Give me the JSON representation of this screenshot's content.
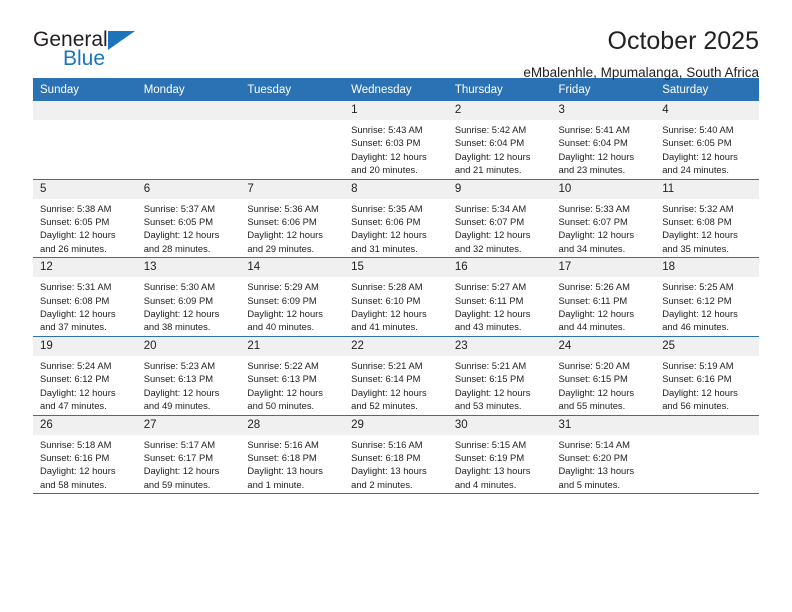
{
  "logo": {
    "word_top": "General",
    "word_bottom": "Blue",
    "triangle_color": "#1b75bc"
  },
  "header": {
    "title": "October 2025",
    "subtitle": "eMbalenhle, Mpumalanga, South Africa",
    "accent_color": "#2b72b4",
    "daynum_band_color": "#f0f0f0"
  },
  "calendar": {
    "weekday_headers": [
      "Sunday",
      "Monday",
      "Tuesday",
      "Wednesday",
      "Thursday",
      "Friday",
      "Saturday"
    ],
    "weeks": [
      [
        {
          "day": "",
          "lines": []
        },
        {
          "day": "",
          "lines": []
        },
        {
          "day": "",
          "lines": []
        },
        {
          "day": "1",
          "lines": [
            "Sunrise: 5:43 AM",
            "Sunset: 6:03 PM",
            "Daylight: 12 hours",
            "and 20 minutes."
          ]
        },
        {
          "day": "2",
          "lines": [
            "Sunrise: 5:42 AM",
            "Sunset: 6:04 PM",
            "Daylight: 12 hours",
            "and 21 minutes."
          ]
        },
        {
          "day": "3",
          "lines": [
            "Sunrise: 5:41 AM",
            "Sunset: 6:04 PM",
            "Daylight: 12 hours",
            "and 23 minutes."
          ]
        },
        {
          "day": "4",
          "lines": [
            "Sunrise: 5:40 AM",
            "Sunset: 6:05 PM",
            "Daylight: 12 hours",
            "and 24 minutes."
          ]
        }
      ],
      [
        {
          "day": "5",
          "lines": [
            "Sunrise: 5:38 AM",
            "Sunset: 6:05 PM",
            "Daylight: 12 hours",
            "and 26 minutes."
          ]
        },
        {
          "day": "6",
          "lines": [
            "Sunrise: 5:37 AM",
            "Sunset: 6:05 PM",
            "Daylight: 12 hours",
            "and 28 minutes."
          ]
        },
        {
          "day": "7",
          "lines": [
            "Sunrise: 5:36 AM",
            "Sunset: 6:06 PM",
            "Daylight: 12 hours",
            "and 29 minutes."
          ]
        },
        {
          "day": "8",
          "lines": [
            "Sunrise: 5:35 AM",
            "Sunset: 6:06 PM",
            "Daylight: 12 hours",
            "and 31 minutes."
          ]
        },
        {
          "day": "9",
          "lines": [
            "Sunrise: 5:34 AM",
            "Sunset: 6:07 PM",
            "Daylight: 12 hours",
            "and 32 minutes."
          ]
        },
        {
          "day": "10",
          "lines": [
            "Sunrise: 5:33 AM",
            "Sunset: 6:07 PM",
            "Daylight: 12 hours",
            "and 34 minutes."
          ]
        },
        {
          "day": "11",
          "lines": [
            "Sunrise: 5:32 AM",
            "Sunset: 6:08 PM",
            "Daylight: 12 hours",
            "and 35 minutes."
          ]
        }
      ],
      [
        {
          "day": "12",
          "lines": [
            "Sunrise: 5:31 AM",
            "Sunset: 6:08 PM",
            "Daylight: 12 hours",
            "and 37 minutes."
          ]
        },
        {
          "day": "13",
          "lines": [
            "Sunrise: 5:30 AM",
            "Sunset: 6:09 PM",
            "Daylight: 12 hours",
            "and 38 minutes."
          ]
        },
        {
          "day": "14",
          "lines": [
            "Sunrise: 5:29 AM",
            "Sunset: 6:09 PM",
            "Daylight: 12 hours",
            "and 40 minutes."
          ]
        },
        {
          "day": "15",
          "lines": [
            "Sunrise: 5:28 AM",
            "Sunset: 6:10 PM",
            "Daylight: 12 hours",
            "and 41 minutes."
          ]
        },
        {
          "day": "16",
          "lines": [
            "Sunrise: 5:27 AM",
            "Sunset: 6:11 PM",
            "Daylight: 12 hours",
            "and 43 minutes."
          ]
        },
        {
          "day": "17",
          "lines": [
            "Sunrise: 5:26 AM",
            "Sunset: 6:11 PM",
            "Daylight: 12 hours",
            "and 44 minutes."
          ]
        },
        {
          "day": "18",
          "lines": [
            "Sunrise: 5:25 AM",
            "Sunset: 6:12 PM",
            "Daylight: 12 hours",
            "and 46 minutes."
          ]
        }
      ],
      [
        {
          "day": "19",
          "lines": [
            "Sunrise: 5:24 AM",
            "Sunset: 6:12 PM",
            "Daylight: 12 hours",
            "and 47 minutes."
          ]
        },
        {
          "day": "20",
          "lines": [
            "Sunrise: 5:23 AM",
            "Sunset: 6:13 PM",
            "Daylight: 12 hours",
            "and 49 minutes."
          ]
        },
        {
          "day": "21",
          "lines": [
            "Sunrise: 5:22 AM",
            "Sunset: 6:13 PM",
            "Daylight: 12 hours",
            "and 50 minutes."
          ]
        },
        {
          "day": "22",
          "lines": [
            "Sunrise: 5:21 AM",
            "Sunset: 6:14 PM",
            "Daylight: 12 hours",
            "and 52 minutes."
          ]
        },
        {
          "day": "23",
          "lines": [
            "Sunrise: 5:21 AM",
            "Sunset: 6:15 PM",
            "Daylight: 12 hours",
            "and 53 minutes."
          ]
        },
        {
          "day": "24",
          "lines": [
            "Sunrise: 5:20 AM",
            "Sunset: 6:15 PM",
            "Daylight: 12 hours",
            "and 55 minutes."
          ]
        },
        {
          "day": "25",
          "lines": [
            "Sunrise: 5:19 AM",
            "Sunset: 6:16 PM",
            "Daylight: 12 hours",
            "and 56 minutes."
          ]
        }
      ],
      [
        {
          "day": "26",
          "lines": [
            "Sunrise: 5:18 AM",
            "Sunset: 6:16 PM",
            "Daylight: 12 hours",
            "and 58 minutes."
          ]
        },
        {
          "day": "27",
          "lines": [
            "Sunrise: 5:17 AM",
            "Sunset: 6:17 PM",
            "Daylight: 12 hours",
            "and 59 minutes."
          ]
        },
        {
          "day": "28",
          "lines": [
            "Sunrise: 5:16 AM",
            "Sunset: 6:18 PM",
            "Daylight: 13 hours",
            "and 1 minute."
          ]
        },
        {
          "day": "29",
          "lines": [
            "Sunrise: 5:16 AM",
            "Sunset: 6:18 PM",
            "Daylight: 13 hours",
            "and 2 minutes."
          ]
        },
        {
          "day": "30",
          "lines": [
            "Sunrise: 5:15 AM",
            "Sunset: 6:19 PM",
            "Daylight: 13 hours",
            "and 4 minutes."
          ]
        },
        {
          "day": "31",
          "lines": [
            "Sunrise: 5:14 AM",
            "Sunset: 6:20 PM",
            "Daylight: 13 hours",
            "and 5 minutes."
          ]
        },
        {
          "day": "",
          "lines": []
        }
      ]
    ]
  }
}
